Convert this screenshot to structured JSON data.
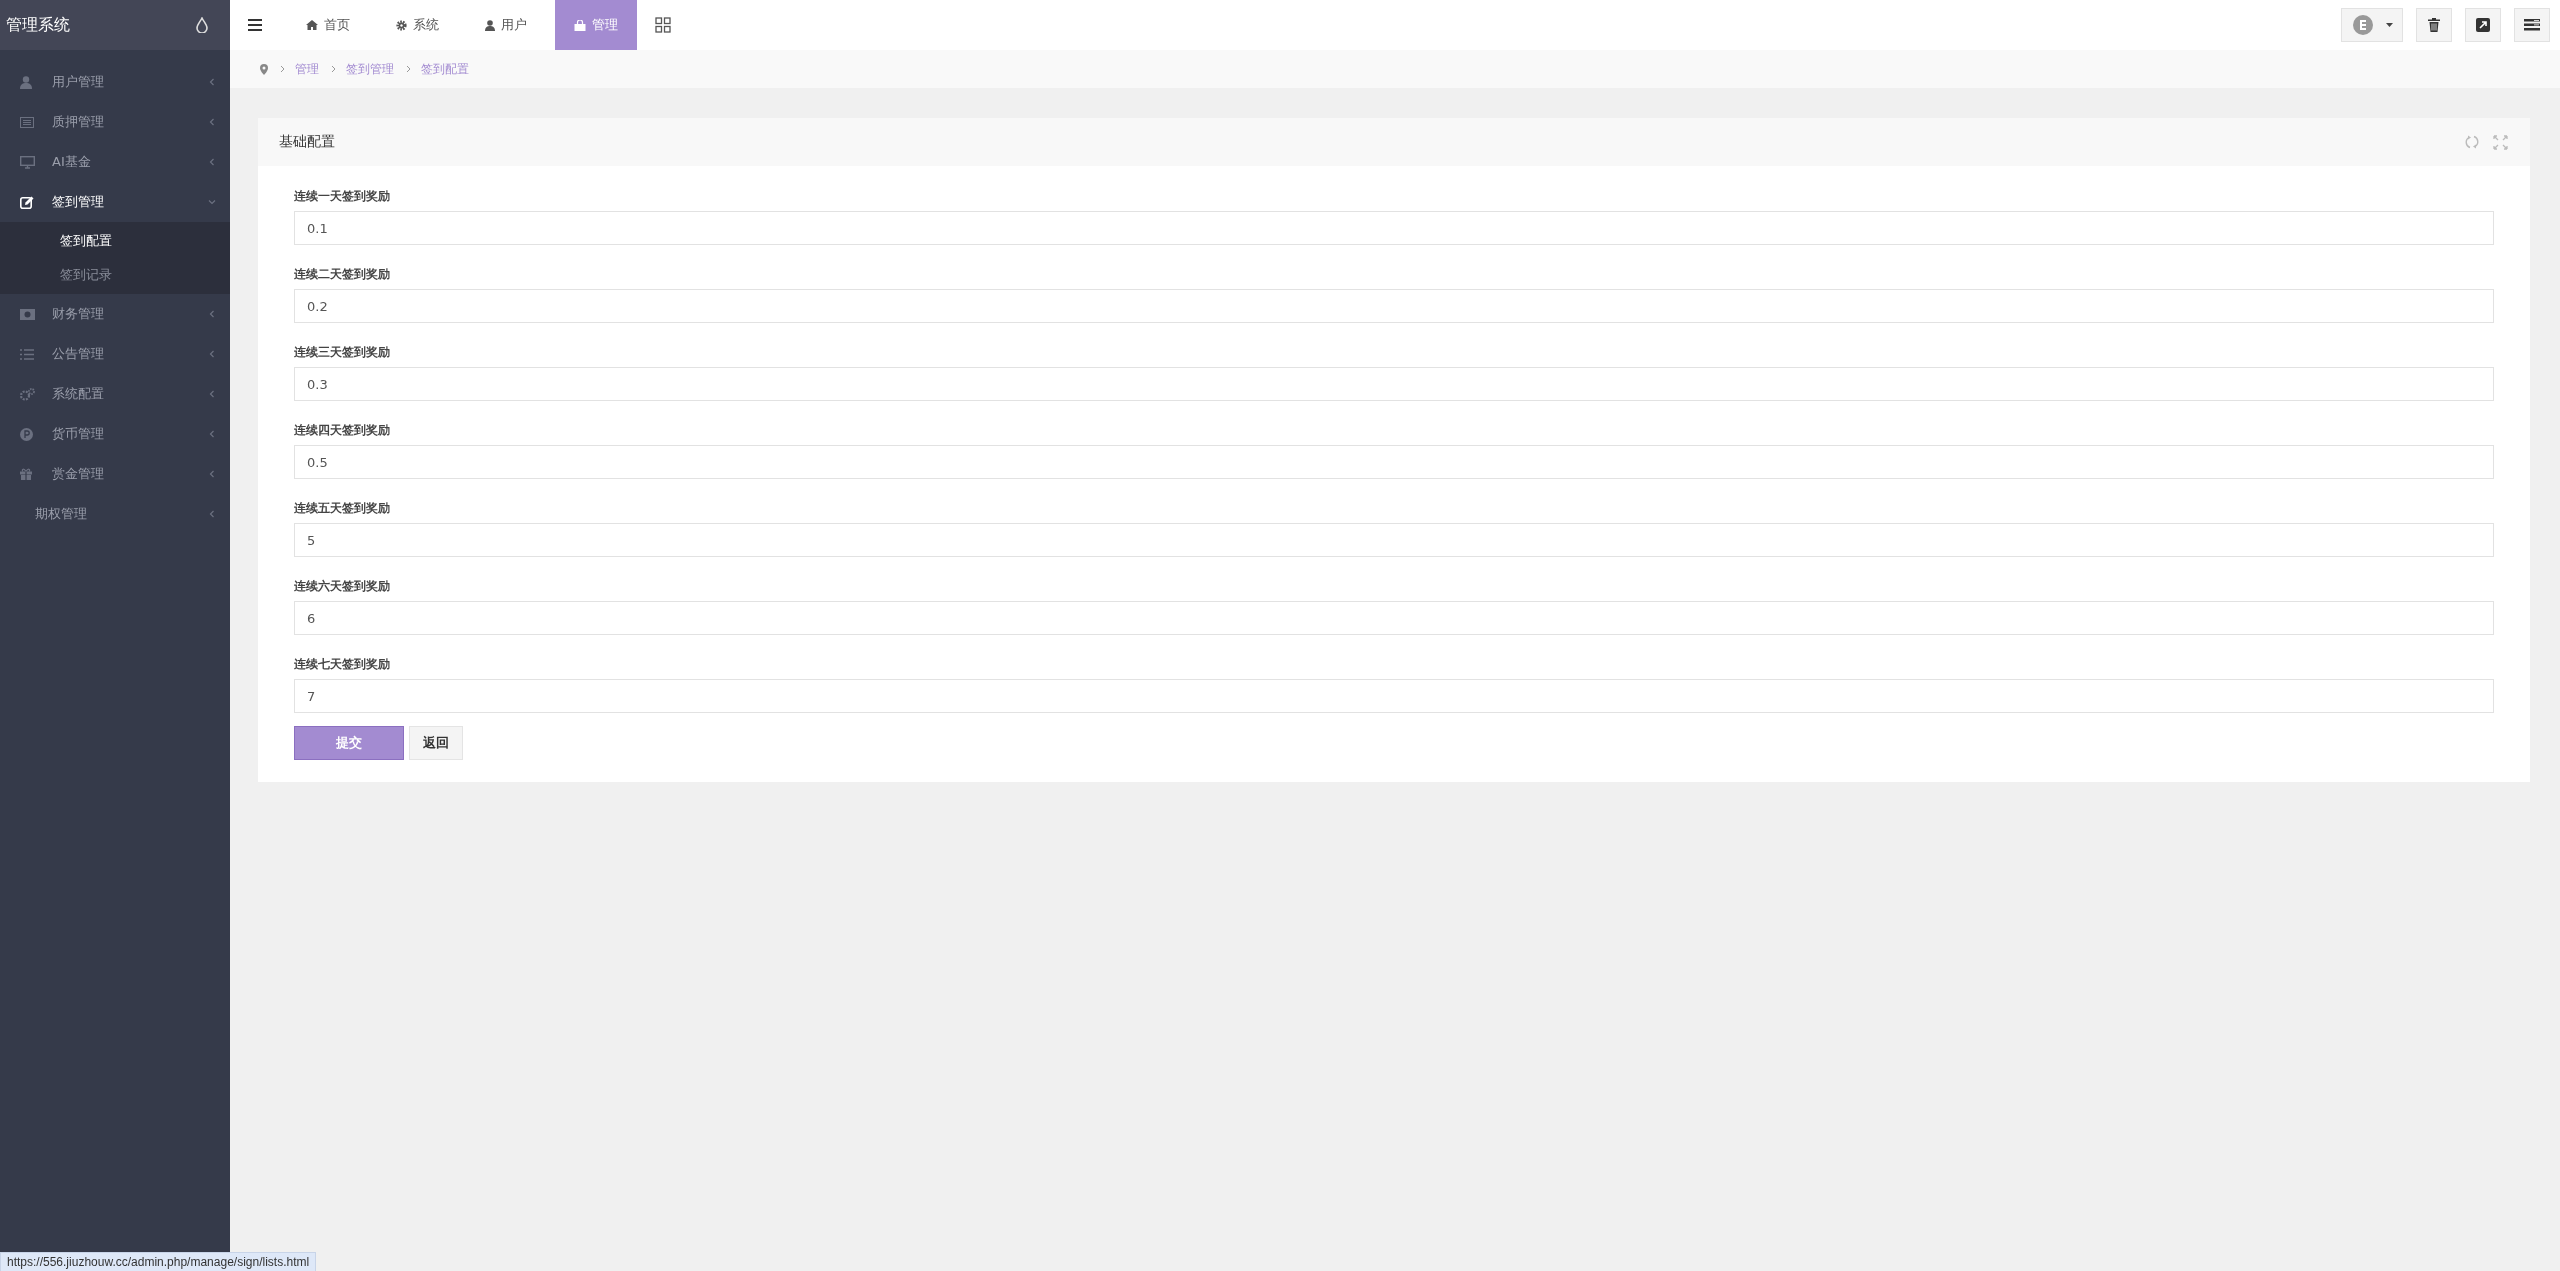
{
  "sidebar": {
    "title": "管理系统",
    "items": [
      {
        "label": "用户管理",
        "expanded": false,
        "selected": false
      },
      {
        "label": "质押管理",
        "expanded": false,
        "selected": false
      },
      {
        "label": "AI基金",
        "expanded": false,
        "selected": false
      },
      {
        "label": "签到管理",
        "expanded": true,
        "selected": true,
        "children": [
          {
            "label": "签到配置",
            "selected": true
          },
          {
            "label": "签到记录",
            "selected": false
          }
        ]
      },
      {
        "label": "财务管理",
        "expanded": false,
        "selected": false
      },
      {
        "label": "公告管理",
        "expanded": false,
        "selected": false
      },
      {
        "label": "系统配置",
        "expanded": false,
        "selected": false
      },
      {
        "label": "货币管理",
        "expanded": false,
        "selected": false
      },
      {
        "label": "赏金管理",
        "expanded": false,
        "selected": false
      },
      {
        "label": "期权管理",
        "expanded": false,
        "selected": false
      }
    ]
  },
  "nav_tabs": [
    {
      "label": "首页",
      "selected": false
    },
    {
      "label": "系统",
      "selected": false
    },
    {
      "label": "用户",
      "selected": false
    },
    {
      "label": "管理",
      "selected": true
    }
  ],
  "breadcrumb": [
    "管理",
    "签到管理",
    "签到配置"
  ],
  "card": {
    "title": "基础配置",
    "fields": [
      {
        "label": "连续一天签到奖励",
        "value": "0.1"
      },
      {
        "label": "连续二天签到奖励",
        "value": "0.2"
      },
      {
        "label": "连续三天签到奖励",
        "value": "0.3"
      },
      {
        "label": "连续四天签到奖励",
        "value": "0.5"
      },
      {
        "label": "连续五天签到奖励",
        "value": "5"
      },
      {
        "label": "连续六天签到奖励",
        "value": "6"
      },
      {
        "label": "连续七天签到奖励",
        "value": "7"
      }
    ],
    "buttons": [
      {
        "label": "提交",
        "kind": "primary"
      },
      {
        "label": "返回",
        "kind": "default"
      }
    ]
  },
  "status_url": "https://556.jiuzhouw.cc/admin.php/manage/sign/lists.html"
}
